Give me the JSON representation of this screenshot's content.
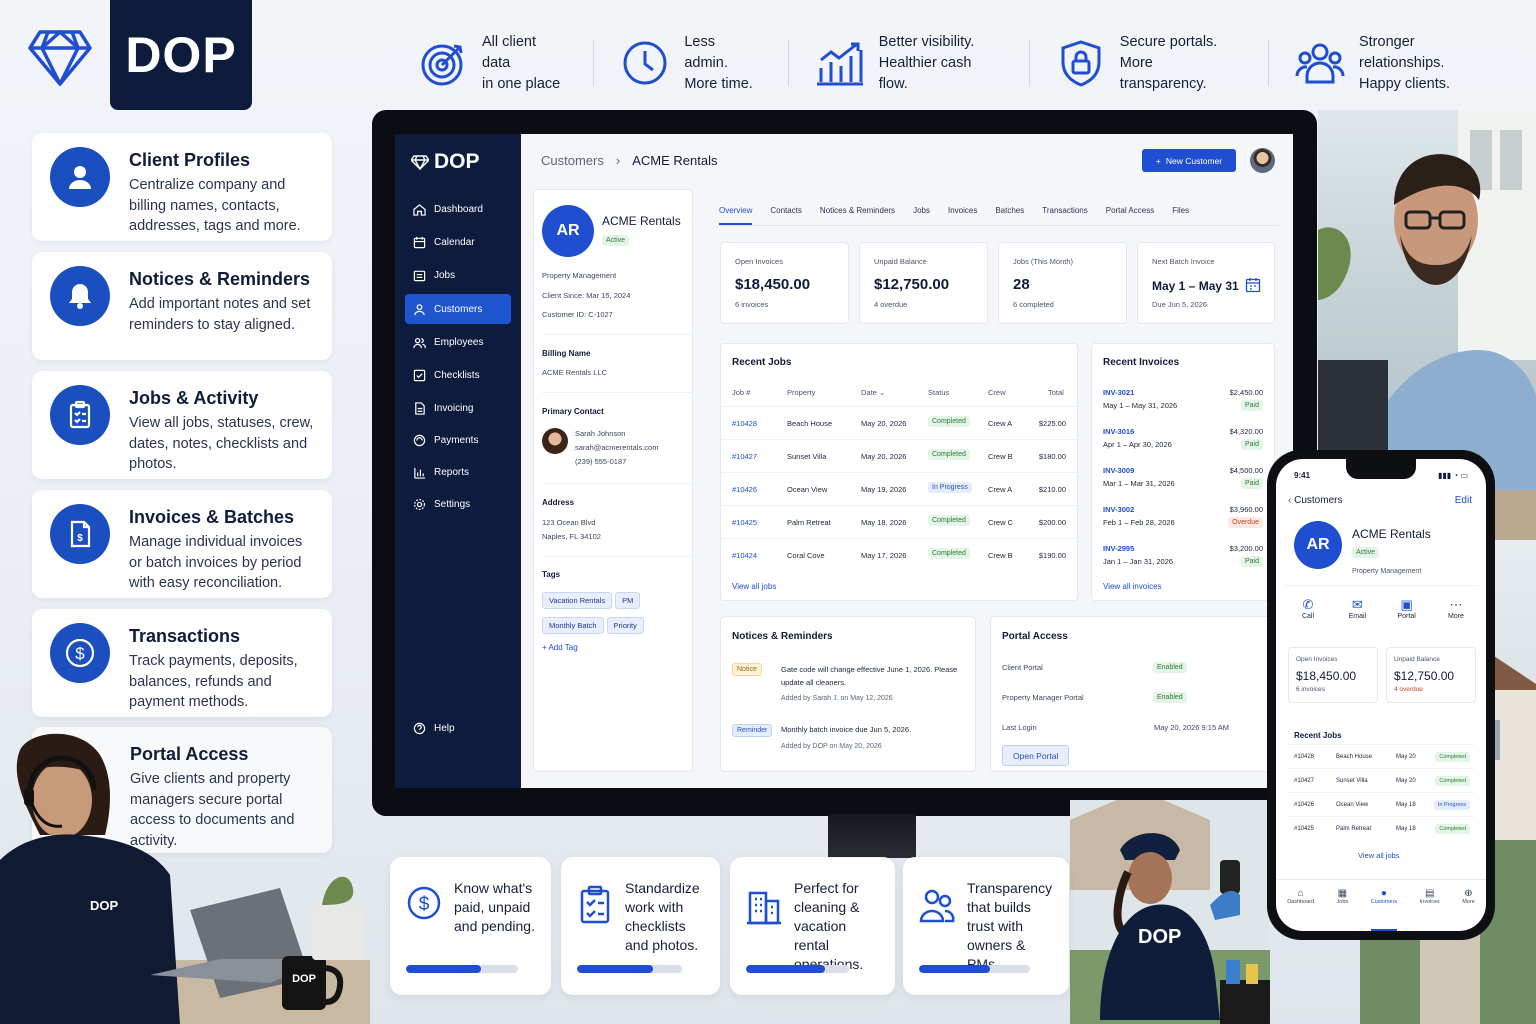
{
  "brand": {
    "name": "DOP"
  },
  "benefits": [
    {
      "icon": "target-icon",
      "line1": "All client data",
      "line2": "in one place"
    },
    {
      "icon": "clock-icon",
      "line1": "Less admin.",
      "line2": "More time."
    },
    {
      "icon": "growth-chart-icon",
      "line1": "Better visibility.",
      "line2": "Healthier cash flow."
    },
    {
      "icon": "shield-lock-icon",
      "line1": "Secure portals.",
      "line2": "More transparency."
    },
    {
      "icon": "people-icon",
      "line1": "Stronger relationships.",
      "line2": "Happy clients."
    }
  ],
  "features": [
    {
      "icon": "user-icon",
      "title": "Client Profiles",
      "desc": "Centralize company and billing names, contacts, addresses, tags and more."
    },
    {
      "icon": "bell-icon",
      "title": "Notices & Reminders",
      "desc": "Add important notes and set reminders to stay aligned."
    },
    {
      "icon": "clipboard-icon",
      "title": "Jobs & Activity",
      "desc": "View all jobs, statuses, crew, dates, notes, checklists and photos."
    },
    {
      "icon": "invoice-icon",
      "title": "Invoices & Batches",
      "desc": "Manage individual invoices or batch invoices by period with easy reconciliation."
    },
    {
      "icon": "dollar-icon",
      "title": "Transactions",
      "desc": "Track payments, deposits, balances, refunds and payment methods."
    },
    {
      "icon": "portal-icon",
      "title": "Portal Access",
      "desc": "Give clients and property managers secure portal access to documents and activity."
    }
  ],
  "app": {
    "nav": [
      "Dashboard",
      "Calendar",
      "Jobs",
      "Customers",
      "Employees",
      "Checklists",
      "Invoicing",
      "Payments",
      "Reports",
      "Settings"
    ],
    "help": "Help",
    "breadcrumb": {
      "parent": "Customers",
      "current": "ACME Rentals"
    },
    "new_customer": "New Customer",
    "customer": {
      "initials": "AR",
      "name": "ACME Rentals",
      "status": "Active",
      "type": "Property Management",
      "since": "Client Since: Mar 15, 2024",
      "id": "Customer ID: C-1027",
      "billing_label": "Billing Name",
      "billing": "ACME Rentals LLC",
      "contact_label": "Primary Contact",
      "contact_name": "Sarah Johnson",
      "contact_email": "sarah@acmerentals.com",
      "contact_phone": "(239) 555-0187",
      "address_label": "Address",
      "address1": "123 Ocean Blvd",
      "address2": "Naples, FL 34102",
      "tags_label": "Tags",
      "tags": [
        "Vacation Rentals",
        "PM",
        "Monthly Batch",
        "Priority"
      ],
      "add_tag": "Add Tag"
    },
    "tabs": [
      "Overview",
      "Contacts",
      "Notices & Reminders",
      "Jobs",
      "Invoices",
      "Batches",
      "Transactions",
      "Portal Access",
      "Files"
    ],
    "kpis": [
      {
        "label": "Open Invoices",
        "value": "$18,450.00",
        "sub": "6 invoices"
      },
      {
        "label": "Unpaid Balance",
        "value": "$12,750.00",
        "sub": "4 overdue"
      },
      {
        "label": "Jobs (This Month)",
        "value": "28",
        "sub": "6 completed"
      },
      {
        "label": "Next Batch Invoice",
        "value": "May 1 – May 31",
        "sub": "Due Jun 5, 2026"
      }
    ],
    "recent_jobs": {
      "title": "Recent Jobs",
      "headers": [
        "Job #",
        "Property",
        "Date",
        "Status",
        "Crew",
        "Total"
      ],
      "rows": [
        {
          "id": "#10428",
          "property": "Beach House",
          "date": "May 20, 2026",
          "status": "Completed",
          "crew": "Crew A",
          "total": "$225.00"
        },
        {
          "id": "#10427",
          "property": "Sunset Villa",
          "date": "May 20, 2026",
          "status": "Completed",
          "crew": "Crew B",
          "total": "$180.00"
        },
        {
          "id": "#10426",
          "property": "Ocean View",
          "date": "May 19, 2026",
          "status": "In Progress",
          "crew": "Crew A",
          "total": "$210.00"
        },
        {
          "id": "#10425",
          "property": "Palm Retreat",
          "date": "May 18, 2026",
          "status": "Completed",
          "crew": "Crew C",
          "total": "$200.00"
        },
        {
          "id": "#10424",
          "property": "Coral Cove",
          "date": "May 17, 2026",
          "status": "Completed",
          "crew": "Crew B",
          "total": "$190.00"
        }
      ],
      "view_all": "View all jobs"
    },
    "recent_invoices": {
      "title": "Recent Invoices",
      "rows": [
        {
          "id": "INV-3021",
          "period": "May 1 – May 31, 2026",
          "amount": "$2,450.00",
          "status": "Paid"
        },
        {
          "id": "INV-3016",
          "period": "Apr 1 – Apr 30, 2026",
          "amount": "$4,320.00",
          "status": "Paid"
        },
        {
          "id": "INV-3009",
          "period": "Mar 1 – Mar 31, 2026",
          "amount": "$4,500.00",
          "status": "Paid"
        },
        {
          "id": "INV-3002",
          "period": "Feb 1 – Feb 28, 2026",
          "amount": "$3,960.00",
          "status": "Overdue"
        },
        {
          "id": "INV-2995",
          "period": "Jan 1 – Jan 31, 2026",
          "amount": "$3,200.00",
          "status": "Paid"
        }
      ],
      "view_all": "View all invoices"
    },
    "notices": {
      "title": "Notices & Reminders",
      "items": [
        {
          "badge": "Notice",
          "text": "Gate code will change effective June 1, 2026. Please update all cleaners.",
          "meta": "Added by Sarah J. on May 12, 2026"
        },
        {
          "badge": "Reminder",
          "text": "Monthly batch invoice due Jun 5, 2026.",
          "meta": "Added by DOP on May 20, 2026"
        }
      ]
    },
    "portal": {
      "title": "Portal Access",
      "client_portal": "Client Portal",
      "client_status": "Enabled",
      "pm_portal": "Property Manager Portal",
      "pm_status": "Enabled",
      "last_login_label": "Last Login",
      "last_login": "May 20, 2026 9:15 AM",
      "open_portal": "Open Portal"
    }
  },
  "phone": {
    "time": "9:41",
    "back": "Customers",
    "edit": "Edit",
    "initials": "AR",
    "name": "ACME Rentals",
    "status": "Active",
    "type": "Property Management",
    "actions": [
      "Call",
      "Email",
      "Portal",
      "More"
    ],
    "kpis": [
      {
        "label": "Open Invoices",
        "value": "$18,450.00",
        "sub": "6 invoices"
      },
      {
        "label": "Unpaid Balance",
        "value": "$12,750.00",
        "sub": "4 overdue"
      }
    ],
    "jobs_title": "Recent Jobs",
    "jobs": [
      {
        "id": "#10428",
        "property": "Beach House",
        "date": "May 20",
        "status": "Completed"
      },
      {
        "id": "#10427",
        "property": "Sunset Villa",
        "date": "May 20",
        "status": "Completed"
      },
      {
        "id": "#10426",
        "property": "Ocean View",
        "date": "May 18",
        "status": "In Progress"
      },
      {
        "id": "#10425",
        "property": "Palm Retreat",
        "date": "May 18",
        "status": "Completed"
      }
    ],
    "view_all": "View all jobs",
    "tabbar": [
      "Dashboard",
      "Jobs",
      "Customers",
      "Invoices",
      "More"
    ]
  },
  "bottom_cards": [
    {
      "icon": "dollar-icon",
      "text": "Know what's paid, unpaid and pending.",
      "progress": 0.67
    },
    {
      "icon": "checklist-icon",
      "text": "Standardize work with checklists and photos.",
      "progress": 0.72
    },
    {
      "icon": "building-icon",
      "text": "Perfect for cleaning & vacation rental operations.",
      "progress": 0.77
    },
    {
      "icon": "people-icon",
      "text": "Transparency that builds trust with owners & PMs.",
      "progress": 0.64
    }
  ],
  "mug_text": "DOP",
  "shirt_text": "DOP",
  "colors": {
    "navy": "#0d1b3d",
    "accent": "#1f4fd0",
    "success": "#2f7a3a",
    "danger": "#c2432a"
  }
}
